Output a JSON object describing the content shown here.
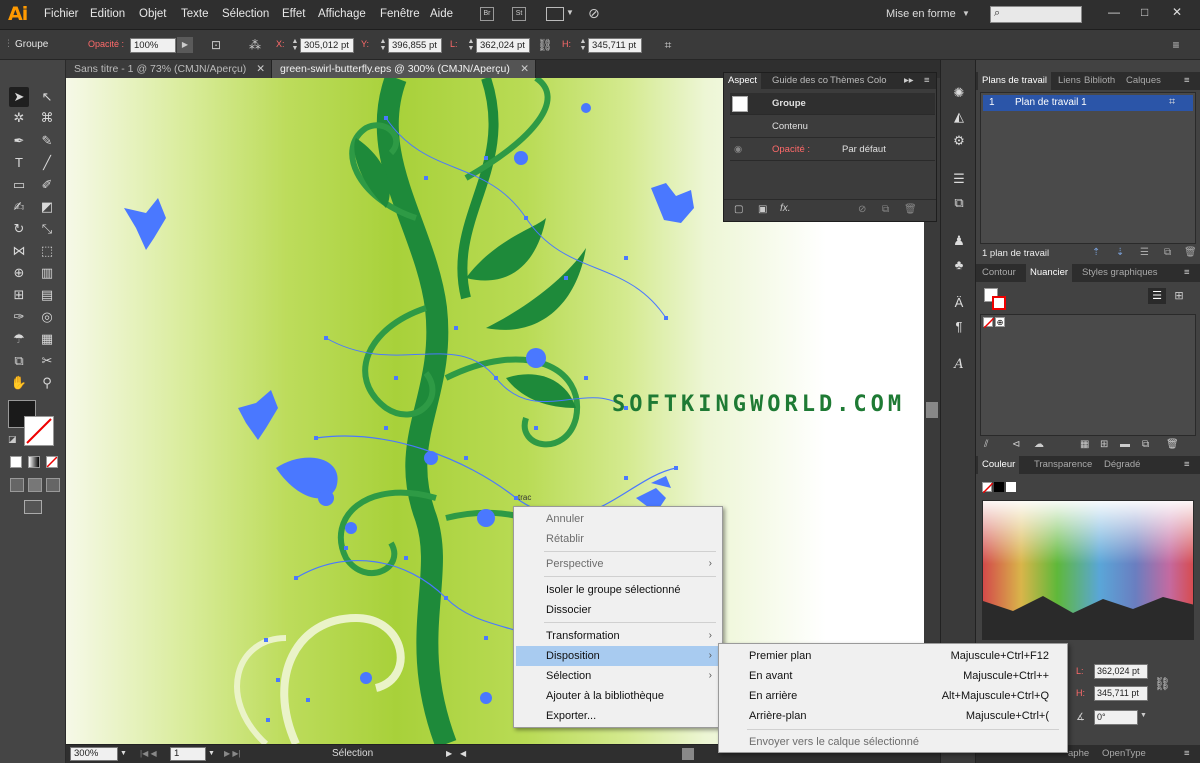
{
  "app": {
    "logo": "Ai"
  },
  "menubar": {
    "items": [
      "Fichier",
      "Edition",
      "Objet",
      "Texte",
      "Sélection",
      "Effet",
      "Affichage",
      "Fenêtre",
      "Aide"
    ],
    "br_icon": "Br",
    "st_icon": "St",
    "workspace": "Mise en forme",
    "window_controls": [
      "—",
      "□",
      "✕"
    ]
  },
  "controlbar": {
    "selection_type": "Groupe",
    "opacity_label": "Opacité :",
    "opacity_value": "100%",
    "x_label": "X:",
    "x_value": "305,012 pt",
    "y_label": "Y:",
    "y_value": "396,855 pt",
    "w_label": "L:",
    "w_value": "362,024 pt",
    "h_label": "H:",
    "h_value": "345,711 pt"
  },
  "doc_tabs": [
    {
      "label": "Sans titre - 1 @ 73% (CMJN/Aperçu)",
      "close": "✕"
    },
    {
      "label": "green-swirl-butterfly.eps @ 300% (CMJN/Aperçu)",
      "close": "✕"
    }
  ],
  "canvas": {
    "watermark": "SOFTKINGWORLD.COM",
    "tooltip": "trac"
  },
  "statusbar": {
    "zoom": "300%",
    "artboard": "1",
    "tool": "Sélection"
  },
  "aspect_panel": {
    "tabs": [
      "Aspect",
      "Guide des co",
      "Thèmes Colo"
    ],
    "rows": {
      "groupe": "Groupe",
      "contenu": "Contenu",
      "opacity_label": "Opacité :",
      "opacity_value": "Par défaut"
    }
  },
  "artboards_panel": {
    "tabs": [
      "Plans de travail",
      "Liens",
      "Biblioth",
      "Calques"
    ],
    "row_index": "1",
    "row_name": "Plan de travail 1",
    "footer": "1 plan de travail"
  },
  "swatches_panel": {
    "tabs": [
      "Contour",
      "Nuancier",
      "Styles graphiques"
    ]
  },
  "color_panel": {
    "tabs": [
      "Couleur",
      "Transparence",
      "Dégradé"
    ]
  },
  "transform_panel": {
    "w_label": "L:",
    "w_value": "362,024 pt",
    "h_label": "H:",
    "h_value": "345,711 pt",
    "angle_value": "0°"
  },
  "bottom_tabs": [
    "aphe",
    "OpenType"
  ],
  "context_menu": {
    "items": [
      {
        "label": "Annuler",
        "disabled": true
      },
      {
        "label": "Rétablir",
        "disabled": true
      },
      {
        "label": "Perspective",
        "disabled": true,
        "submenu": true
      },
      {
        "label": "Isoler le groupe sélectionné"
      },
      {
        "label": "Dissocier"
      },
      {
        "label": "Transformation",
        "submenu": true
      },
      {
        "label": "Disposition",
        "submenu": true,
        "highlighted": true
      },
      {
        "label": "Sélection",
        "submenu": true
      },
      {
        "label": "Ajouter à la bibliothèque"
      },
      {
        "label": "Exporter..."
      }
    ]
  },
  "submenu": {
    "items": [
      {
        "label": "Premier plan",
        "shortcut": "Majuscule+Ctrl+F12"
      },
      {
        "label": "En avant",
        "shortcut": "Majuscule+Ctrl++"
      },
      {
        "label": "En arrière",
        "shortcut": "Alt+Majuscule+Ctrl+Q"
      },
      {
        "label": "Arrière-plan",
        "shortcut": "Majuscule+Ctrl+("
      },
      {
        "label": "Envoyer vers le calque sélectionné",
        "disabled": true
      }
    ]
  },
  "colors": {
    "accent": "#ff9a00",
    "selection_blue": "#4a78ff",
    "swirl_green": "#1e8a3a",
    "menu_highlight": "#a8cbf0"
  }
}
